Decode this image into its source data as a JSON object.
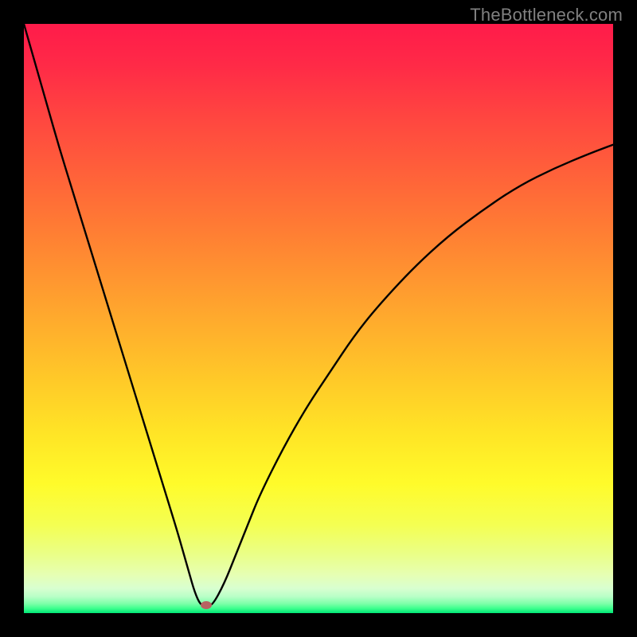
{
  "watermark": "TheBottleneck.com",
  "marker": {
    "color": "#b86262"
  },
  "chart_data": {
    "type": "line",
    "title": "",
    "xlabel": "",
    "ylabel": "",
    "xlim": [
      0,
      100
    ],
    "ylim": [
      0,
      100
    ],
    "series": [
      {
        "name": "curve",
        "x": [
          0,
          2,
          4,
          6,
          8,
          10,
          12,
          14,
          16,
          18,
          20,
          22,
          24,
          26,
          27,
          28,
          29,
          30,
          31,
          32,
          34,
          36,
          38,
          40,
          44,
          48,
          52,
          56,
          60,
          66,
          72,
          78,
          84,
          90,
          96,
          100
        ],
        "y": [
          100,
          93,
          86,
          79,
          72.5,
          66,
          59.5,
          53,
          46.5,
          40,
          33.5,
          27,
          20.5,
          14,
          10.5,
          7,
          3.5,
          1.3,
          1.3,
          1.3,
          5,
          10,
          15,
          20,
          28,
          35,
          41,
          47,
          52,
          58.5,
          64,
          68.5,
          72.5,
          75.5,
          78,
          79.5
        ]
      }
    ],
    "annotations": [
      {
        "type": "marker",
        "x": 31,
        "y": 1.3
      }
    ],
    "background_gradient": {
      "stops": [
        {
          "pos": 0.0,
          "color": "#ff1b4a"
        },
        {
          "pos": 0.07,
          "color": "#ff2a47"
        },
        {
          "pos": 0.16,
          "color": "#ff4640"
        },
        {
          "pos": 0.25,
          "color": "#ff603a"
        },
        {
          "pos": 0.34,
          "color": "#ff7a34"
        },
        {
          "pos": 0.43,
          "color": "#ff9530"
        },
        {
          "pos": 0.52,
          "color": "#ffb02c"
        },
        {
          "pos": 0.61,
          "color": "#ffcb28"
        },
        {
          "pos": 0.7,
          "color": "#ffe626"
        },
        {
          "pos": 0.78,
          "color": "#fffb2a"
        },
        {
          "pos": 0.85,
          "color": "#f4ff52"
        },
        {
          "pos": 0.9,
          "color": "#eaff87"
        },
        {
          "pos": 0.935,
          "color": "#e6ffb3"
        },
        {
          "pos": 0.958,
          "color": "#d8ffd0"
        },
        {
          "pos": 0.972,
          "color": "#b8ffc7"
        },
        {
          "pos": 0.984,
          "color": "#7dffa9"
        },
        {
          "pos": 0.992,
          "color": "#3dff8e"
        },
        {
          "pos": 1.0,
          "color": "#00e676"
        }
      ]
    }
  }
}
